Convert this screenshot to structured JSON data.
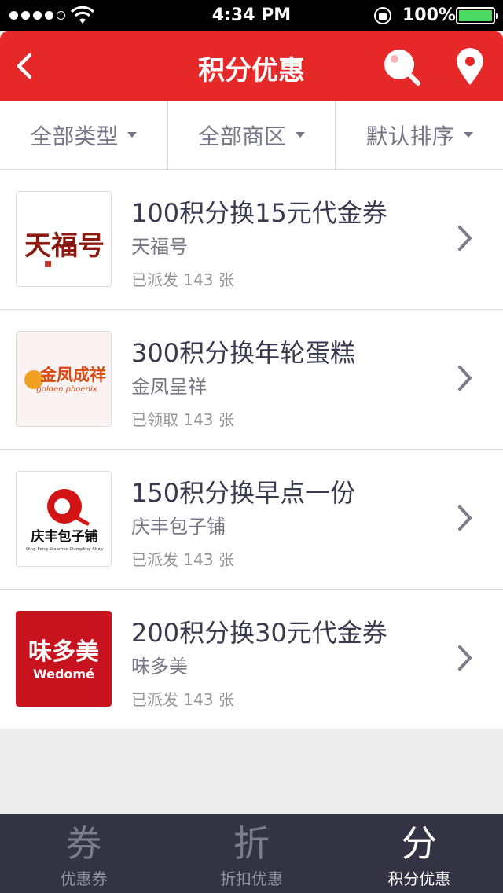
{
  "status_bar": {
    "time": "4:34 PM",
    "battery": "100%"
  },
  "nav": {
    "title": "积分优惠",
    "icons": [
      "back-icon",
      "search-icon",
      "location-pin-icon"
    ]
  },
  "filters": [
    {
      "label": "全部类型"
    },
    {
      "label": "全部商区"
    },
    {
      "label": "默认排序"
    }
  ],
  "items": [
    {
      "title": "100积分换15元代金券",
      "shop": "天福号",
      "status": "已派发 143 张",
      "logo_text": "天福号",
      "logo_color": "#8b1a10"
    },
    {
      "title": "300积分换年轮蛋糕",
      "shop": "金凤呈祥",
      "status": "已领取 143 张",
      "logo_text": "金凤成祥",
      "logo_sub": "golden phoenix",
      "logo_color": "#d9480f"
    },
    {
      "title": "150积分换早点一份",
      "shop": "庆丰包子铺",
      "status": "已派发 143 张",
      "logo_text": "庆丰包子铺",
      "logo_sub": "Qing-Feng Steamed Dumpling Shop",
      "logo_color": "#d31414"
    },
    {
      "title": "200积分换30元代金券",
      "shop": "味多美",
      "status": "已派发 143 张",
      "logo_text": "味多美",
      "logo_sub": "Wedomé",
      "logo_color": "#c8121e"
    }
  ],
  "tabs": [
    {
      "icon": "券",
      "label": "优惠券",
      "active": false
    },
    {
      "icon": "折",
      "label": "折扣优惠",
      "active": false
    },
    {
      "icon": "分",
      "label": "积分优惠",
      "active": true
    }
  ],
  "colors": {
    "brand_red": "#e62828",
    "title_text": "#383a4e",
    "sub_text": "#767786",
    "meta_text": "#939498",
    "background": "#ededed",
    "tabbar": "#333344"
  }
}
